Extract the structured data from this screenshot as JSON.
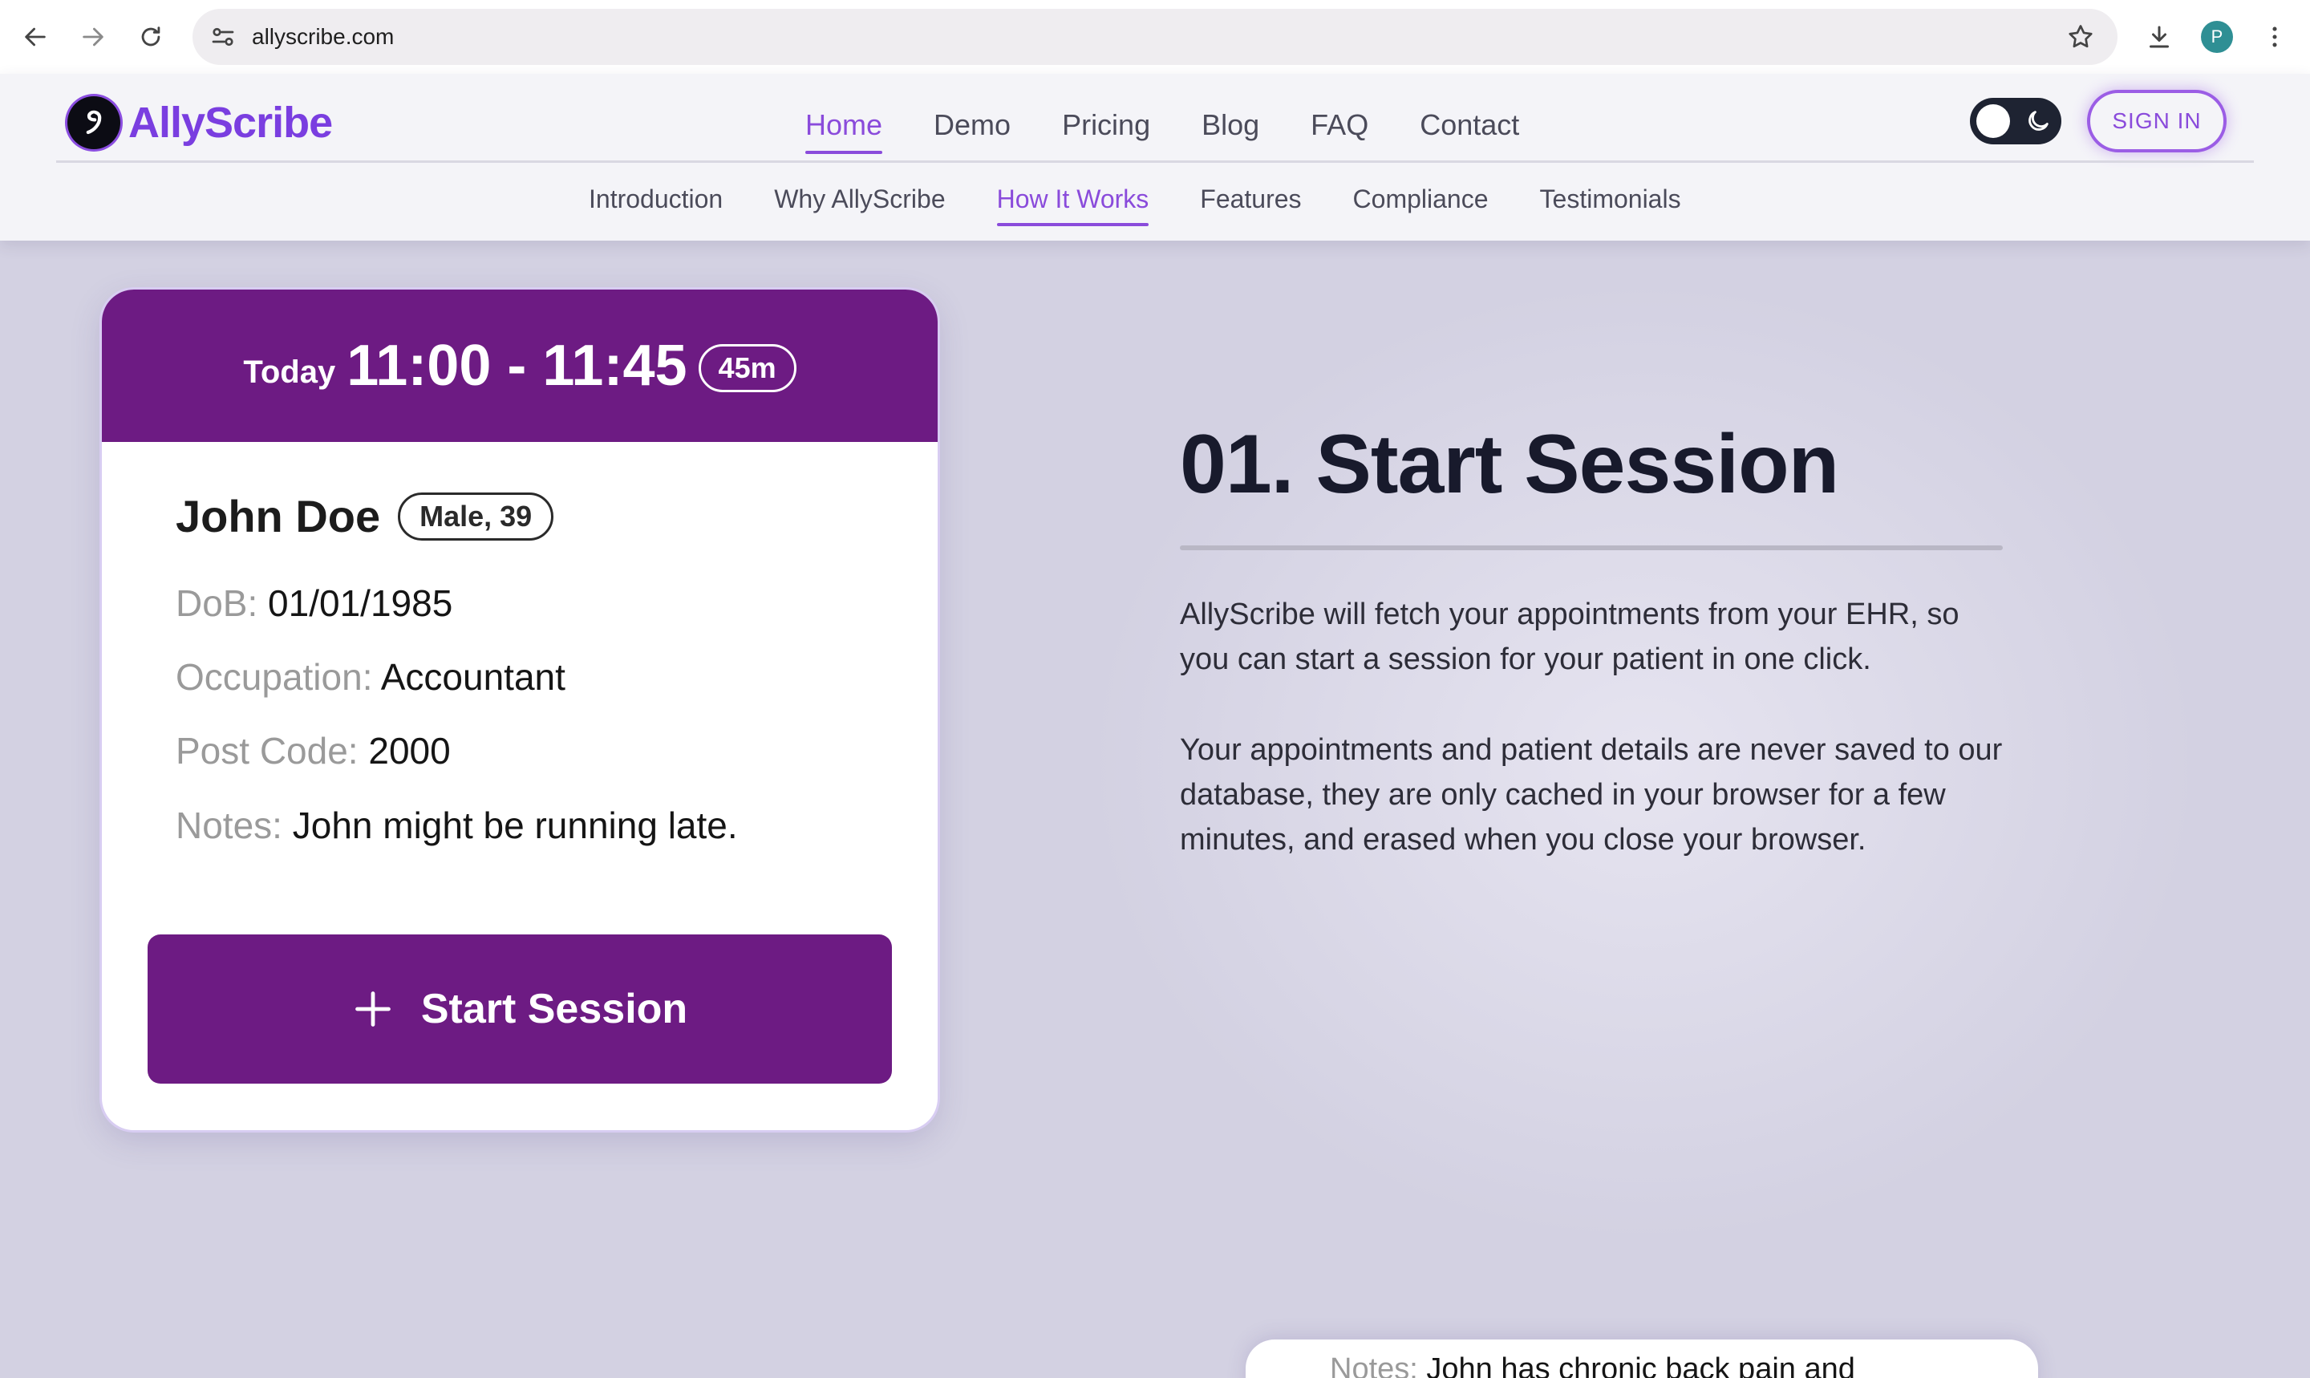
{
  "browser": {
    "url": "allyscribe.com",
    "profile_initial": "P"
  },
  "header": {
    "brand": "AllyScribe",
    "main_nav": [
      {
        "label": "Home"
      },
      {
        "label": "Demo"
      },
      {
        "label": "Pricing"
      },
      {
        "label": "Blog"
      },
      {
        "label": "FAQ"
      },
      {
        "label": "Contact"
      }
    ],
    "main_nav_active": "Home",
    "sub_nav": [
      {
        "label": "Introduction"
      },
      {
        "label": "Why AllyScribe"
      },
      {
        "label": "How It Works"
      },
      {
        "label": "Features"
      },
      {
        "label": "Compliance"
      },
      {
        "label": "Testimonials"
      }
    ],
    "sub_nav_active": "How It Works",
    "sign_in_label": "SIGN IN",
    "theme": "light"
  },
  "appointment": {
    "day": "Today",
    "time_range": "11:00 - 11:45",
    "duration": "45m",
    "patient_name": "John Doe",
    "patient_tag": "Male, 39",
    "fields": [
      {
        "label": "DoB:",
        "value": "01/01/1985"
      },
      {
        "label": "Occupation:",
        "value": "Accountant"
      },
      {
        "label": "Post Code:",
        "value": "2000"
      },
      {
        "label": "Notes:",
        "value": "John might be running late."
      }
    ],
    "start_button_label": "Start Session"
  },
  "step": {
    "title": "01. Start Session",
    "paragraphs": [
      "AllyScribe will fetch your appointments from your EHR, so you can start a session for your patient in one click.",
      "Your appointments and patient details are never saved to our database, they are only cached in your browser for a few minutes, and erased when you close your browser."
    ]
  },
  "next_card": {
    "label": "Notes:",
    "value": "John has chronic back pain and"
  },
  "colors": {
    "accent": "#8a4bdb",
    "card_purple": "#6d1b83",
    "page_bg": "#d3d1e2"
  },
  "icons": {
    "back": "arrow-left-icon",
    "forward": "arrow-right-icon",
    "reload": "reload-icon",
    "site_info": "tune-icon",
    "bookmark": "star-icon",
    "download": "download-icon",
    "menu": "kebab-menu-icon",
    "theme": "moon-icon",
    "start": "plus-icon"
  }
}
